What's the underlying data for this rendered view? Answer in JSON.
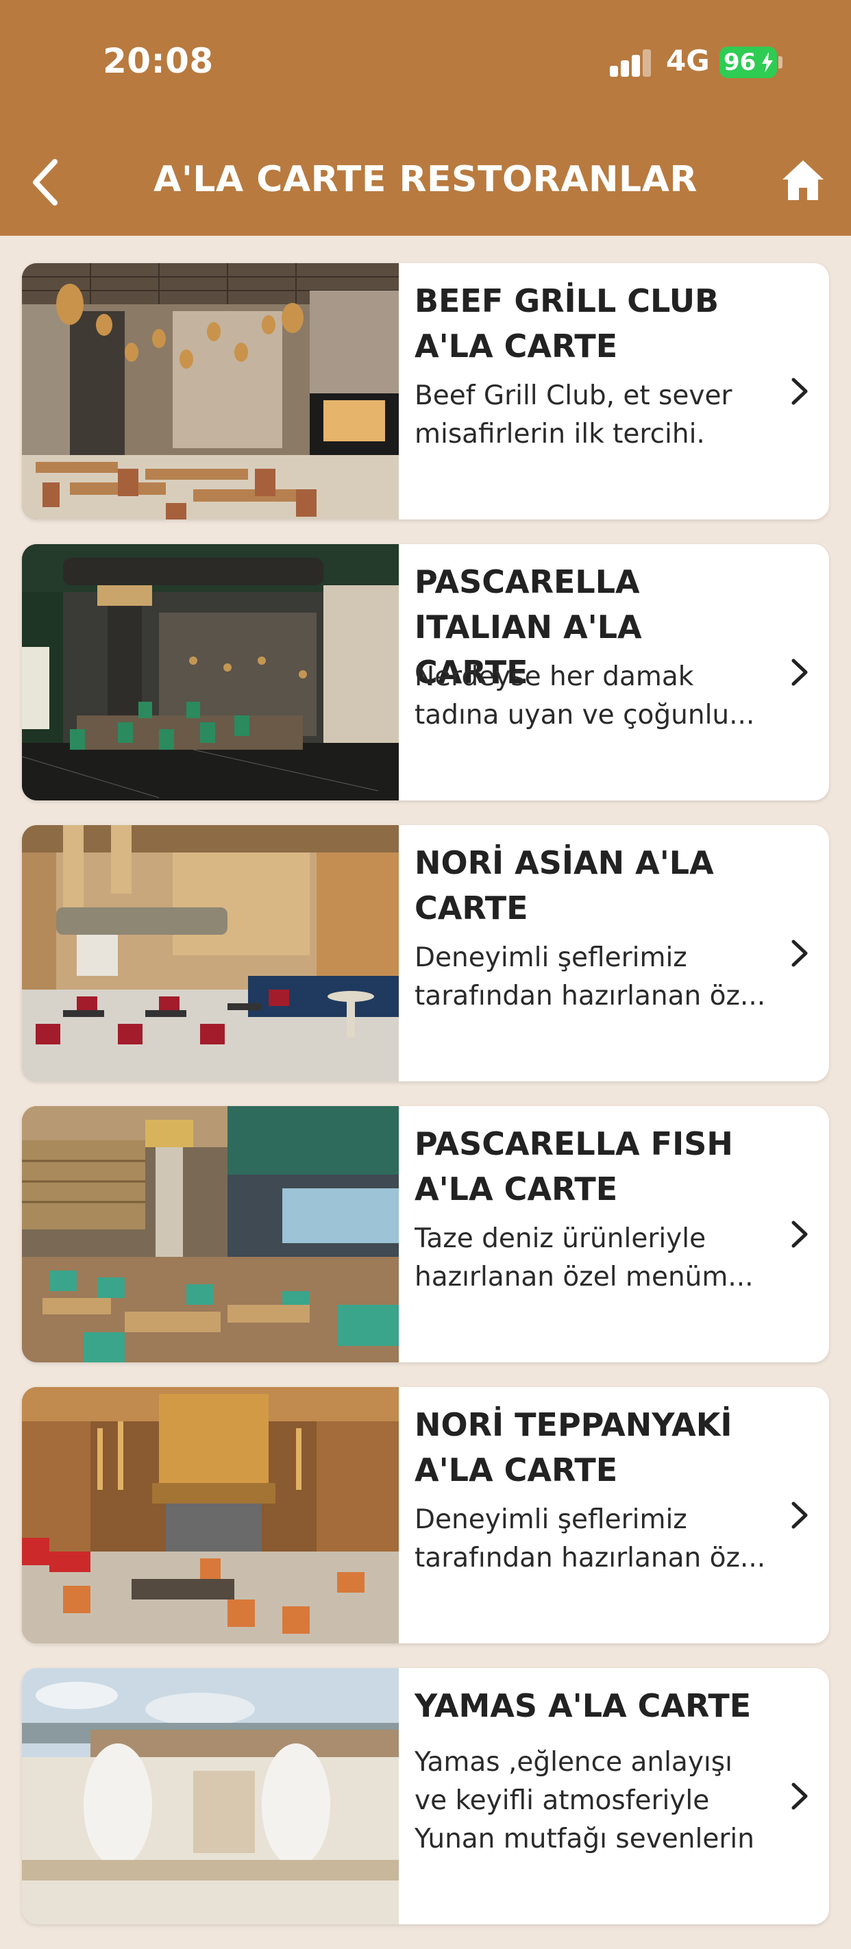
{
  "status_bar": {
    "time": "20:08",
    "network": "4G",
    "battery": "96"
  },
  "header": {
    "title": "A'LA CARTE RESTORANLAR"
  },
  "colors": {
    "header": "#b87a3f",
    "background": "#f1e6dc",
    "battery": "#2ecc52"
  },
  "restaurants": [
    {
      "title": "BEEF GRİLL CLUB A'LA CARTE",
      "description": "Beef Grill Club, et sever misafirlerin ilk tercihi."
    },
    {
      "title": "PASCARELLA ITALIAN A'LA CARTE",
      "description": "Nerdeyse her damak tadına uyan ve çoğunlu..."
    },
    {
      "title": "NORİ ASİAN A'LA CARTE",
      "description": " Deneyimli şeflerimiz tarafından hazırlanan öz..."
    },
    {
      "title": "PASCARELLA FISH A'LA CARTE",
      "description": "Taze deniz ürünleriyle hazırlanan özel menüm..."
    },
    {
      "title": "NORİ TEPPANYAKİ A'LA CARTE",
      "description": "Deneyimli şeflerimiz tarafından hazırlanan öz..."
    },
    {
      "title": "YAMAS A'LA CARTE",
      "description": "Yamas ,eğlence anlayışı ve keyifli atmosferiyle Yunan mutfağı sevenlerin"
    }
  ]
}
